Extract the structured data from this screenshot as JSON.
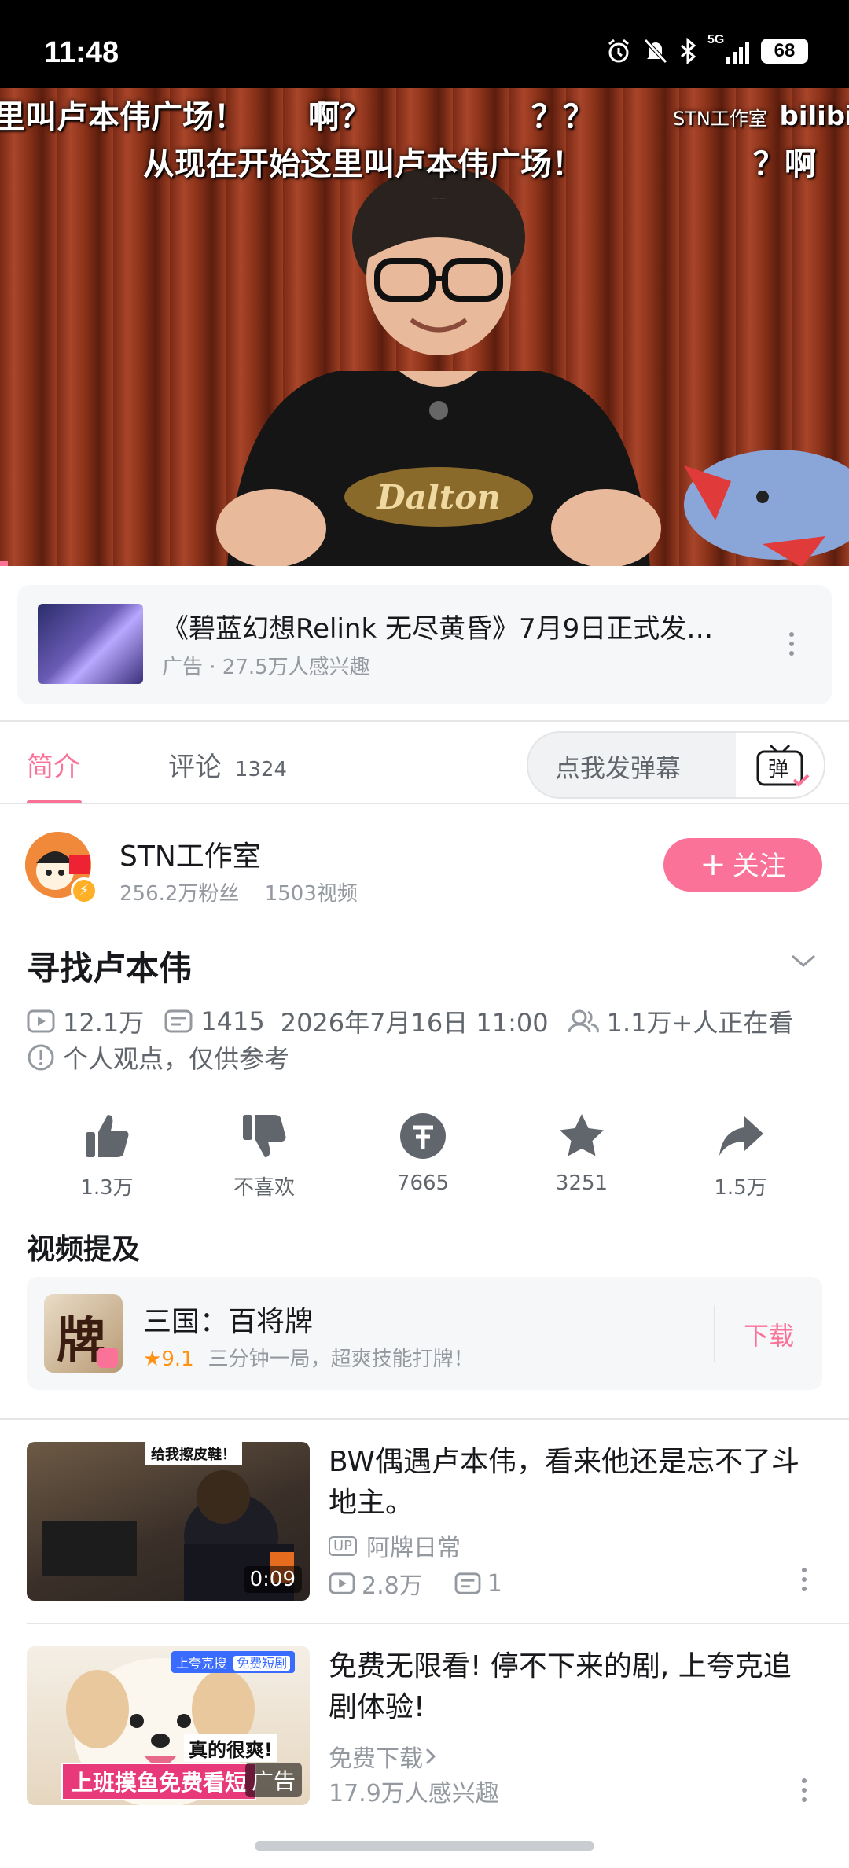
{
  "status_bar": {
    "time": "11:48",
    "battery": "68",
    "network": "5G"
  },
  "video": {
    "subtitle_top_left": "里叫卢本伟广场！",
    "subtitle_top_mid": "啊？",
    "subtitle_top_q": "？？",
    "subtitle_main": "从现在开始这里叫卢本伟广场！",
    "subtitle_right": "？啊",
    "watermark": "STN工作室",
    "site_logo": "bilibili",
    "shirt_text": "Dalton"
  },
  "ad": {
    "title": "《碧蓝幻想Relink 无尽黄昏》7月9日正式发…",
    "meta": "广告 · 27.5万人感兴趣"
  },
  "tabs": {
    "intro": "简介",
    "comments": "评论",
    "comments_count": "1324"
  },
  "danmaku": {
    "placeholder": "点我发弹幕",
    "button": "弹"
  },
  "uploader": {
    "name": "STN工作室",
    "fans": "256.2万粉丝",
    "videos": "1503视频",
    "follow": "关注",
    "follow_plus": "+"
  },
  "video_info": {
    "title": "寻找卢本伟",
    "views": "12.1万",
    "danmaku_count": "1415",
    "datetime": "2026年7月16日 11:00",
    "watching": "1.1万+人正在看",
    "disclaimer": "个人观点，仅供参考"
  },
  "actions": {
    "like": "1.3万",
    "dislike": "不喜欢",
    "coin": "7665",
    "favorite": "3251",
    "share": "1.5万"
  },
  "mentions": {
    "heading": "视频提及",
    "game_name": "三国：百将牌",
    "rating": "9.1",
    "description": "三分钟一局，超爽技能打牌！",
    "download": "下载",
    "icon_char": "牌"
  },
  "feed": [
    {
      "title": "BW偶遇卢本伟，看来他还是忘不了斗地主。",
      "duration": "0:09",
      "author": "阿牌日常",
      "up_tag": "UP",
      "views": "2.8万",
      "comments": "1",
      "thumb_caption": "给我擦皮鞋！"
    },
    {
      "title": "免费无限看! 停不下来的剧, 上夸克追剧体验!",
      "download_link": "免费下载",
      "interest": "17.9万人感兴趣",
      "thumb_caption": "真的很爽!",
      "thumb_banner": "上班摸鱼免费看短",
      "ad_tag": "广告",
      "thumb_brand": "上夸克搜",
      "thumb_brand2": "免费短剧"
    }
  ],
  "colors": {
    "accent": "#fb7299",
    "text": "#18191c",
    "muted": "#9499a0"
  }
}
